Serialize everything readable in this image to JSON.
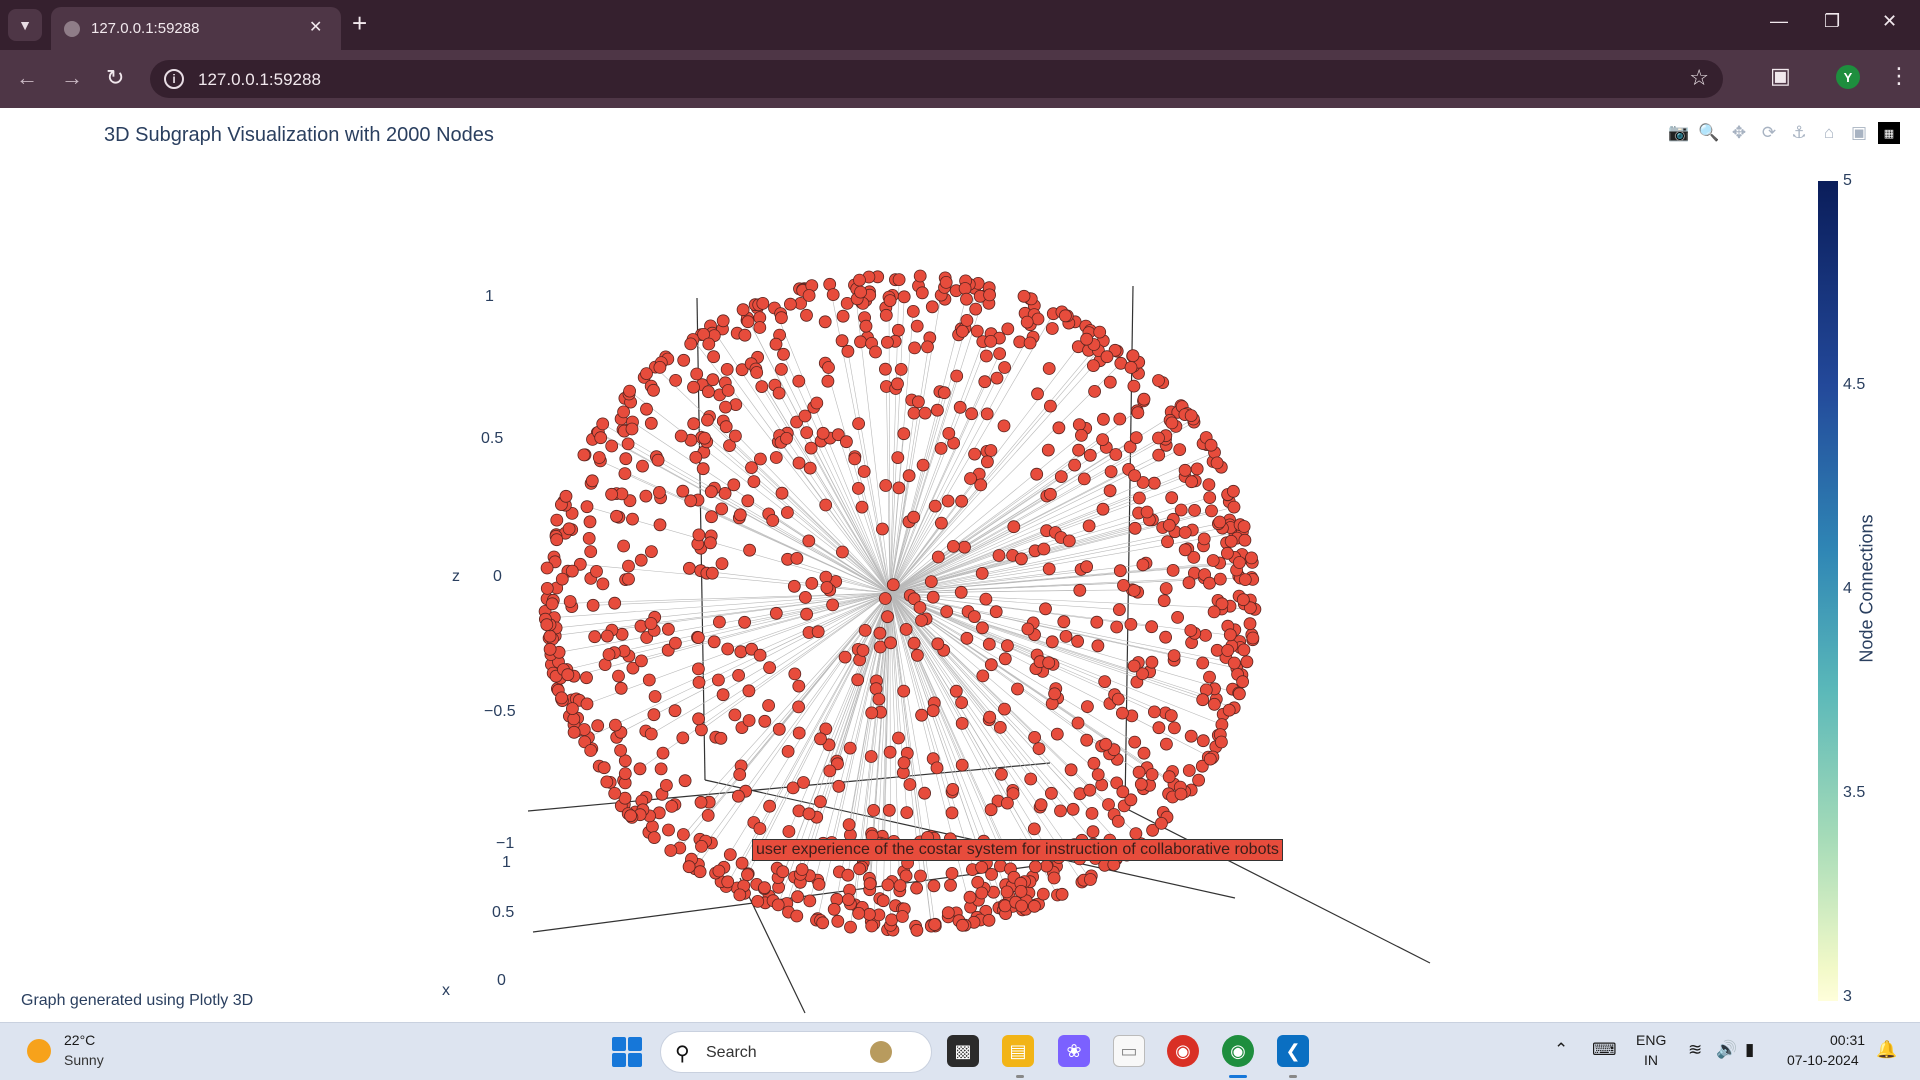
{
  "browser": {
    "tab_title": "127.0.0.1:59288",
    "url": "127.0.0.1:59288",
    "profile_initial": "Y"
  },
  "plot": {
    "title": "3D Subgraph Visualization with 2000 Nodes",
    "footer": "Graph generated using Plotly 3D",
    "hover_label": "user experience of the costar system for instruction of collaborative robots",
    "z_axis": {
      "label": "z",
      "ticks": [
        "1",
        "0.5",
        "0",
        "−0.5",
        "−1"
      ]
    },
    "x_axis": {
      "label": "x",
      "ticks": [
        "1",
        "0.5",
        "0"
      ]
    },
    "colorbar": {
      "title": "Node Connections",
      "ticks": [
        "5",
        "4.5",
        "4",
        "3.5",
        "3"
      ]
    },
    "node_color": "#e74c3c",
    "edge_color": "#b9b9b9"
  },
  "chart_data": {
    "type": "scatter",
    "title": "3D Subgraph Visualization with 2000 Nodes",
    "node_count": 2000,
    "zlim": [
      -1,
      1
    ],
    "colorbar_range": [
      3,
      5
    ],
    "colorbar_title": "Node Connections"
  },
  "taskbar": {
    "weather_temp": "22°C",
    "weather_desc": "Sunny",
    "search_placeholder": "Search",
    "lang_top": "ENG",
    "lang_bottom": "IN",
    "time": "00:31",
    "date": "07-10-2024"
  }
}
